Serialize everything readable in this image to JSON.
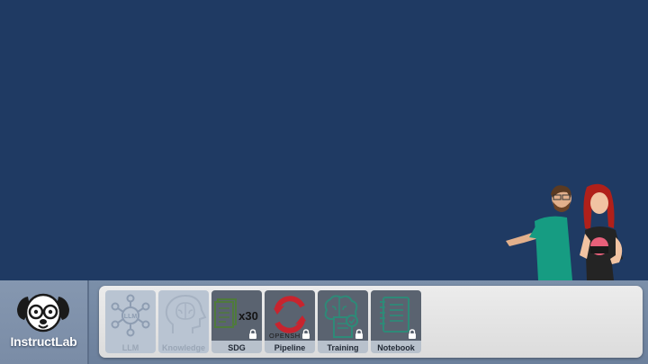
{
  "brand": {
    "name": "InstructLab",
    "logo_icon": "dog-glasses-icon"
  },
  "tray": {
    "tiles": [
      {
        "label": "LLM",
        "icon": "llm-network-icon",
        "locked": false
      },
      {
        "label": "Knowledge",
        "icon": "brain-head-icon",
        "locked": false
      },
      {
        "label": "SDG",
        "icon": "document-multiply-icon",
        "badge": "x30",
        "locked": true
      },
      {
        "label": "Pipeline",
        "icon": "openshift-icon",
        "badge": "OPENSH",
        "locked": true
      },
      {
        "label": "Training",
        "icon": "brain-document-icon",
        "locked": true
      },
      {
        "label": "Notebook",
        "icon": "notebook-icon",
        "locked": true
      }
    ]
  },
  "colors": {
    "background": "#1f3a63",
    "tray": "#e6e6e6",
    "locked_tile": "#5a6370",
    "unlocked_tile": "#b9c4d2"
  }
}
